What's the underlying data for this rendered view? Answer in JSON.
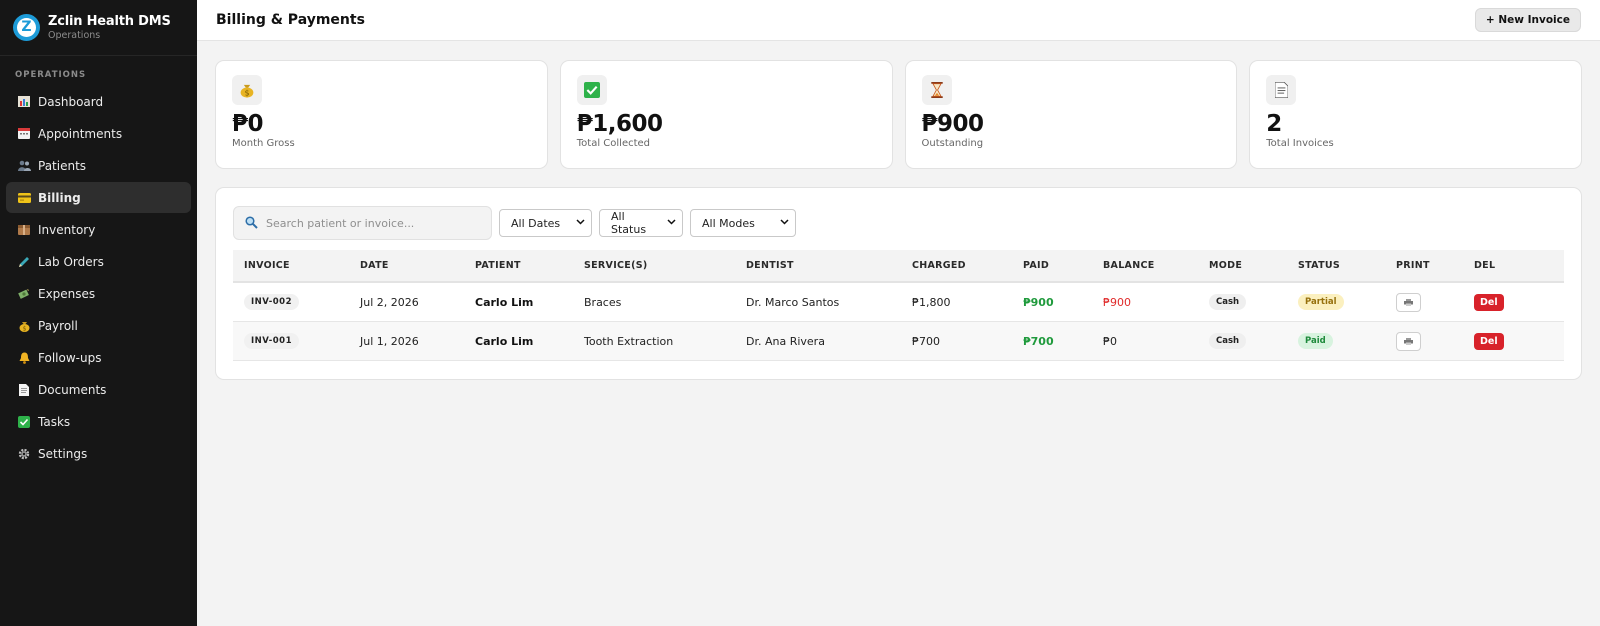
{
  "app": {
    "name": "Zclin Health DMS",
    "subtitle": "Operations",
    "logo_letter": "Z"
  },
  "sidebar": {
    "section_label": "OPERATIONS",
    "items": [
      {
        "label": "Dashboard",
        "icon": "bar-chart-icon"
      },
      {
        "label": "Appointments",
        "icon": "calendar-icon"
      },
      {
        "label": "Patients",
        "icon": "people-icon"
      },
      {
        "label": "Billing",
        "icon": "credit-card-icon",
        "active": true
      },
      {
        "label": "Inventory",
        "icon": "box-icon"
      },
      {
        "label": "Lab Orders",
        "icon": "pen-icon"
      },
      {
        "label": "Expenses",
        "icon": "money-icon"
      },
      {
        "label": "Payroll",
        "icon": "money-bag-icon"
      },
      {
        "label": "Follow-ups",
        "icon": "bell-icon"
      },
      {
        "label": "Documents",
        "icon": "document-icon"
      },
      {
        "label": "Tasks",
        "icon": "checkbox-icon"
      },
      {
        "label": "Settings",
        "icon": "gear-icon"
      }
    ]
  },
  "header": {
    "title": "Billing & Payments",
    "new_invoice_label": "+ New Invoice"
  },
  "stats": [
    {
      "value": "₱0",
      "label": "Month Gross",
      "icon": "money-bag-icon"
    },
    {
      "value": "₱1,600",
      "label": "Total Collected",
      "icon": "check-icon"
    },
    {
      "value": "₱900",
      "label": "Outstanding",
      "icon": "hourglass-icon"
    },
    {
      "value": "2",
      "label": "Total Invoices",
      "icon": "document-icon"
    }
  ],
  "filters": {
    "search_placeholder": "Search patient or invoice...",
    "dates": "All Dates",
    "status": "All Status",
    "modes": "All Modes"
  },
  "table": {
    "columns": [
      "INVOICE",
      "DATE",
      "PATIENT",
      "SERVICE(S)",
      "DENTIST",
      "CHARGED",
      "PAID",
      "BALANCE",
      "MODE",
      "STATUS",
      "PRINT",
      "DEL"
    ],
    "rows": [
      {
        "invoice": "INV-002",
        "date": "Jul 2, 2026",
        "patient": "Carlo Lim",
        "service": "Braces",
        "dentist": "Dr. Marco Santos",
        "charged": "₱1,800",
        "paid": "₱900",
        "balance": "₱900",
        "mode": "Cash",
        "status": "Partial",
        "del": "Del"
      },
      {
        "invoice": "INV-001",
        "date": "Jul 1, 2026",
        "patient": "Carlo Lim",
        "service": "Tooth Extraction",
        "dentist": "Dr. Ana Rivera",
        "charged": "₱700",
        "paid": "₱700",
        "balance": "₱0",
        "mode": "Cash",
        "status": "Paid",
        "del": "Del"
      }
    ]
  },
  "colors": {
    "sidebar_bg": "#161616",
    "brand_blue": "#1d9bd8",
    "paid_green": "#1f9a3c",
    "balance_red": "#e02a2a",
    "delete_red": "#d8222a"
  }
}
